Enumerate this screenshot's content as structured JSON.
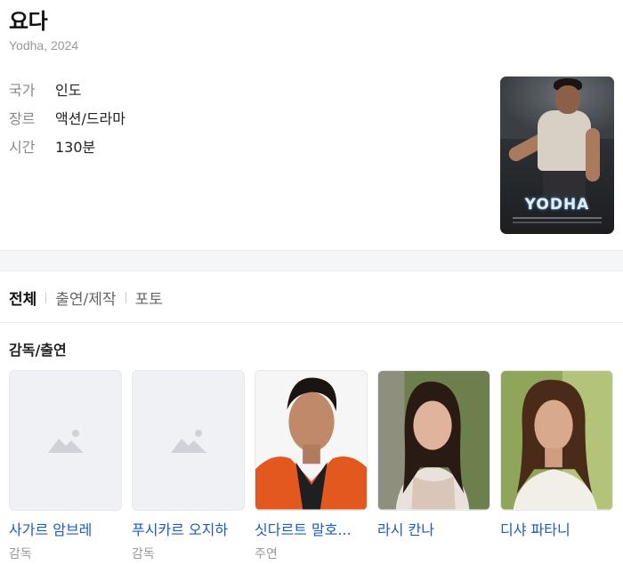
{
  "movie": {
    "title": "요다",
    "subtitle": "Yodha, 2024",
    "info": [
      {
        "key": "국가",
        "value": "인도"
      },
      {
        "key": "장르",
        "value": "액션/드라마"
      },
      {
        "key": "시간",
        "value": "130분"
      }
    ],
    "poster_icon": "movie-poster-yodha",
    "poster_text": "YODHA"
  },
  "tabs": [
    {
      "label": "전체",
      "active": true
    },
    {
      "label": "출연/제작",
      "active": false
    },
    {
      "label": "포토",
      "active": false
    }
  ],
  "cast_section": {
    "title": "감독/출연",
    "people": [
      {
        "name": "사가르 암브레",
        "role": "감독",
        "photo": "placeholder-image-icon"
      },
      {
        "name": "푸시카르 오지하",
        "role": "감독",
        "photo": "placeholder-image-icon"
      },
      {
        "name": "싯다르트 말호...",
        "role": "주연",
        "photo": "person-photo"
      },
      {
        "name": "라시 칸나",
        "role": "",
        "photo": "person-photo"
      },
      {
        "name": "디샤 파타니",
        "role": "",
        "photo": "person-photo"
      }
    ]
  },
  "colors": {
    "link": "#1a5bc4",
    "muted": "#999999",
    "divider": "#f5f6f8"
  }
}
